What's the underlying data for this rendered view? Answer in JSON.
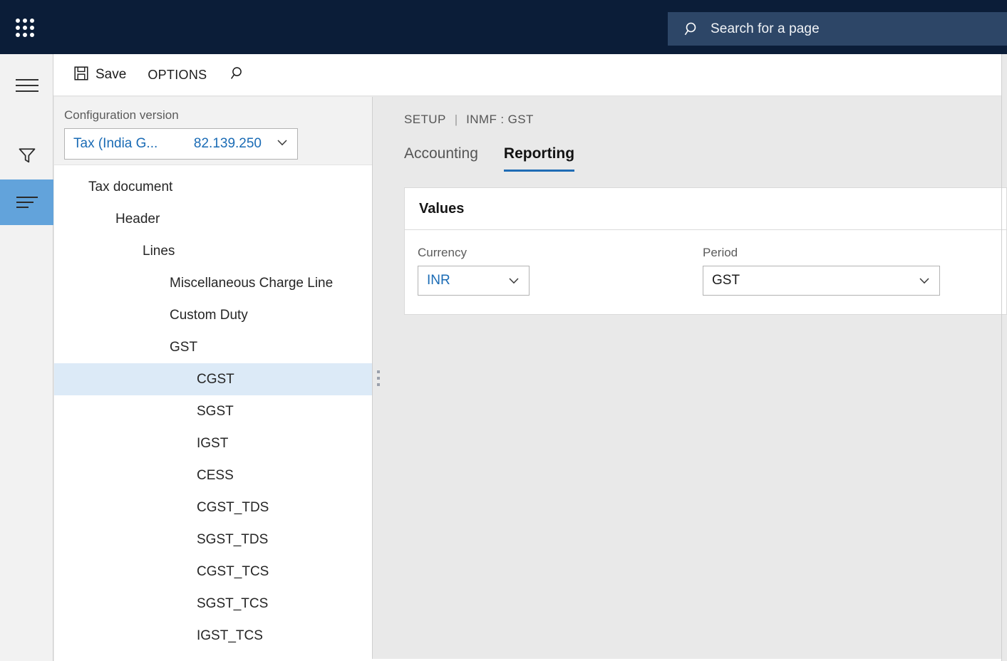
{
  "topbar": {
    "waffle_icon": "app-launcher-icon",
    "search": {
      "icon": "search-icon",
      "placeholder": "Search for a page",
      "value": "Search for a page"
    }
  },
  "rail": {
    "items": [
      {
        "name": "navigation-pane-toggle",
        "icon": "hamburger-icon",
        "selected": false
      },
      {
        "name": "filter",
        "icon": "funnel-icon",
        "selected": false
      },
      {
        "name": "list",
        "icon": "list-icon",
        "selected": true
      }
    ]
  },
  "toolbar": {
    "save_label": "Save",
    "save_icon": "save-floppy-icon",
    "options_label": "OPTIONS",
    "search_icon": "search-icon"
  },
  "left_panel": {
    "config_version_label": "Configuration version",
    "config_version_name": "Tax (India G...",
    "config_version_number": "82.139.250",
    "chevron_icon": "chevron-down-icon",
    "tree": [
      {
        "label": "Tax document",
        "depth": 0,
        "state": "expanded",
        "selected": false
      },
      {
        "label": "Header",
        "depth": 1,
        "state": "expanded",
        "selected": false
      },
      {
        "label": "Lines",
        "depth": 2,
        "state": "expanded",
        "selected": false
      },
      {
        "label": "Miscellaneous Charge Line",
        "depth": 3,
        "state": "leaf",
        "selected": false
      },
      {
        "label": "Custom Duty",
        "depth": 3,
        "state": "collapsed",
        "selected": false
      },
      {
        "label": "GST",
        "depth": 3,
        "state": "expanded",
        "selected": false
      },
      {
        "label": "CGST",
        "depth": 4,
        "state": "collapsed",
        "selected": true
      },
      {
        "label": "SGST",
        "depth": 4,
        "state": "collapsed",
        "selected": false
      },
      {
        "label": "IGST",
        "depth": 4,
        "state": "collapsed",
        "selected": false
      },
      {
        "label": "CESS",
        "depth": 4,
        "state": "collapsed",
        "selected": false
      },
      {
        "label": "CGST_TDS",
        "depth": 4,
        "state": "collapsed",
        "selected": false
      },
      {
        "label": "SGST_TDS",
        "depth": 4,
        "state": "collapsed",
        "selected": false
      },
      {
        "label": "CGST_TCS",
        "depth": 4,
        "state": "collapsed",
        "selected": false
      },
      {
        "label": "SGST_TCS",
        "depth": 4,
        "state": "collapsed",
        "selected": false
      },
      {
        "label": "IGST_TCS",
        "depth": 4,
        "state": "collapsed",
        "selected": false
      }
    ]
  },
  "splitter": {
    "name": "panel-splitter",
    "dots": 3
  },
  "content": {
    "breadcrumb": {
      "root": "SETUP",
      "separator": "|",
      "current": "INMF : GST"
    },
    "tabs": [
      {
        "label": "Accounting",
        "active": false
      },
      {
        "label": "Reporting",
        "active": true
      }
    ],
    "card": {
      "title": "Values",
      "fields": [
        {
          "label": "Currency",
          "value": "INR",
          "tone": "blue",
          "icon": "chevron-down-icon"
        },
        {
          "label": "Period",
          "value": "GST",
          "tone": "dark",
          "icon": "chevron-down-icon"
        }
      ]
    }
  },
  "colors": {
    "navy": "#0b1d38",
    "search_fill": "#2d4667",
    "accent_blue": "#1f6cb5",
    "link_blue": "#1a6bb5",
    "selection": "#dceaf7",
    "rail_selected": "#62a3db",
    "content_bg": "#e9e9e9"
  }
}
